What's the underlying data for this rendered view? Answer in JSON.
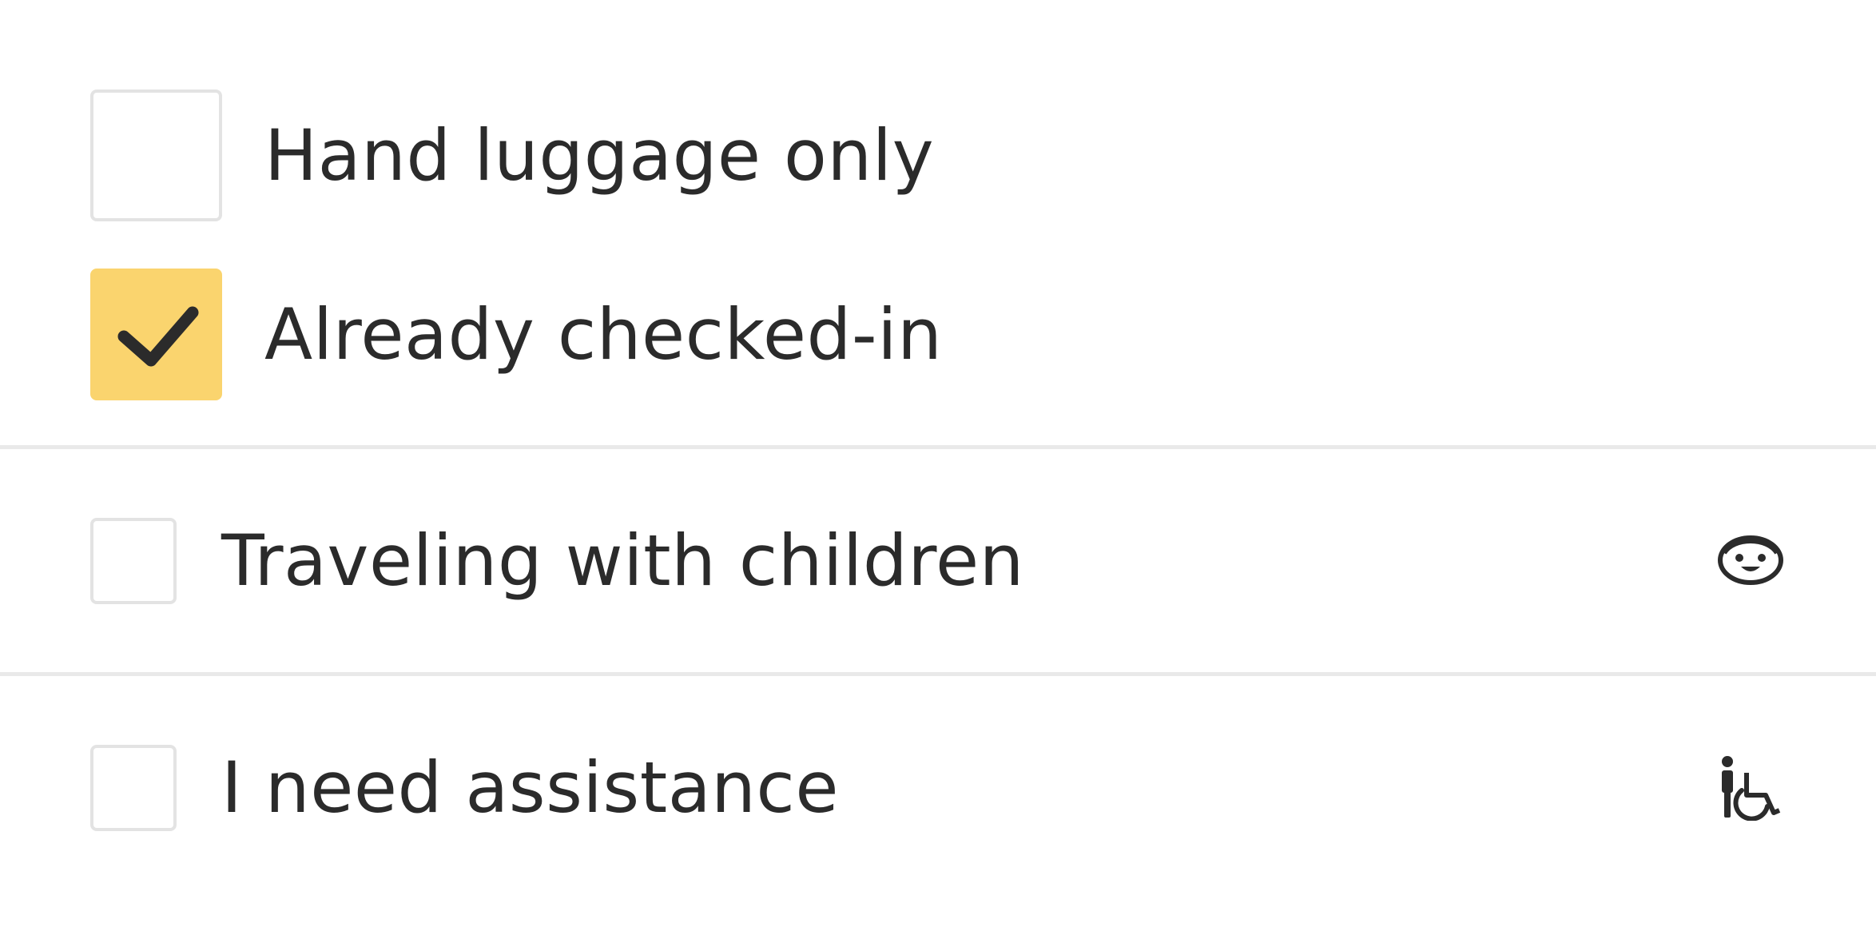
{
  "options": {
    "hand_luggage": {
      "label": "Hand luggage only",
      "checked": false
    },
    "checked_in": {
      "label": "Already checked-in",
      "checked": true
    },
    "children": {
      "label": "Traveling with children",
      "checked": false,
      "icon": "child-face-icon"
    },
    "assistance": {
      "label": "I need assistance",
      "checked": false,
      "icon": "wheelchair-icon"
    }
  },
  "colors": {
    "checked_fill": "#fad46e",
    "checkbox_border": "#e3e3e3",
    "text": "#2b2b2b",
    "divider": "#e9e9e9"
  }
}
